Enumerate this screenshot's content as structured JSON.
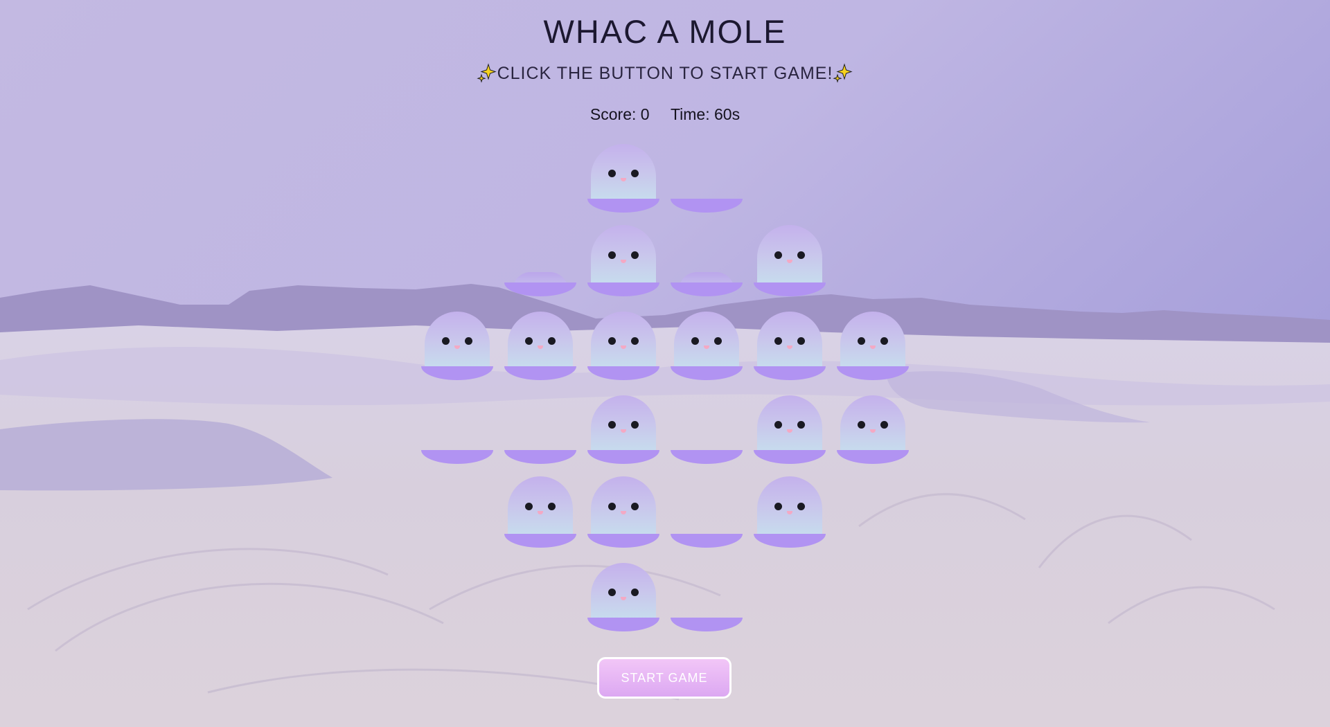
{
  "game": {
    "title": "WHAC A MOLE",
    "subtitle": "CLICK THE BUTTON TO START GAME!",
    "score_label": "Score: 0",
    "time_label": "Time: 60s",
    "start_button": "START GAME"
  },
  "icons": {
    "sparkle_left": "sparkle-icon",
    "sparkle_right": "sparkle-icon"
  },
  "colors": {
    "hole": "#b193f2",
    "button": "#e4b4f4",
    "sky": "#b3a9e0"
  },
  "board": {
    "rows": [
      [
        "empty",
        "empty",
        "mole",
        "hole",
        "empty",
        "empty"
      ],
      [
        "empty",
        "bump",
        "mole",
        "bump",
        "mole",
        "empty"
      ],
      [
        "mole",
        "mole",
        "mole",
        "mole",
        "mole",
        "mole"
      ],
      [
        "hole",
        "hole",
        "mole",
        "hole",
        "mole",
        "mole"
      ],
      [
        "empty",
        "mole",
        "mole",
        "hole",
        "mole",
        "empty"
      ],
      [
        "empty",
        "empty",
        "mole",
        "hole",
        "empty",
        "empty"
      ]
    ]
  }
}
